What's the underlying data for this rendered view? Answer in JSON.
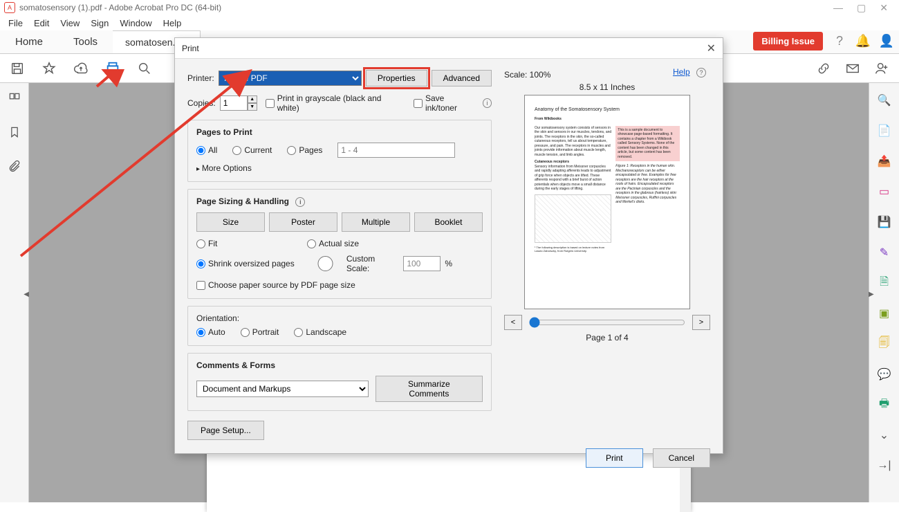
{
  "titlebar": {
    "document_name": "somatosensory (1).pdf",
    "app_name": "Adobe Acrobat Pro DC (64-bit)"
  },
  "menubar": {
    "file": "File",
    "edit": "Edit",
    "view": "View",
    "sign": "Sign",
    "window": "Window",
    "help": "Help"
  },
  "tabrow": {
    "home": "Home",
    "tools": "Tools",
    "doc_tab": "somatosen...",
    "billing": "Billing Issue"
  },
  "toolbar": {},
  "print_dialog": {
    "title": "Print",
    "printer_label": "Printer:",
    "printer_selected": "Adobe PDF",
    "properties": "Properties",
    "advanced": "Advanced",
    "help": "Help",
    "copies_label": "Copies:",
    "copies_value": "1",
    "grayscale": "Print in grayscale (black and white)",
    "save_ink": "Save ink/toner",
    "pages_to_print": {
      "title": "Pages to Print",
      "all": "All",
      "current": "Current",
      "pages": "Pages",
      "range_ph": "1 - 4",
      "more": "More Options"
    },
    "sizing": {
      "title": "Page Sizing & Handling",
      "size": "Size",
      "poster": "Poster",
      "multiple": "Multiple",
      "booklet": "Booklet",
      "fit": "Fit",
      "actual": "Actual size",
      "shrink": "Shrink oversized pages",
      "custom": "Custom Scale:",
      "custom_value": "100",
      "percent": "%",
      "paper_source": "Choose paper source by PDF page size"
    },
    "orientation": {
      "title": "Orientation:",
      "auto": "Auto",
      "portrait": "Portrait",
      "landscape": "Landscape"
    },
    "comments_forms": {
      "title": "Comments & Forms",
      "selected": "Document and Markups",
      "summarize": "Summarize Comments"
    },
    "page_setup": "Page Setup...",
    "scale_label": "Scale: 100%",
    "paper_dim": "8.5 x 11 Inches",
    "preview": {
      "heading": "Anatomy of the Somatosensory System",
      "byline": "From Wikibooks"
    },
    "page_of": "Page 1 of 4",
    "print_btn": "Print",
    "cancel_btn": "Cancel"
  }
}
